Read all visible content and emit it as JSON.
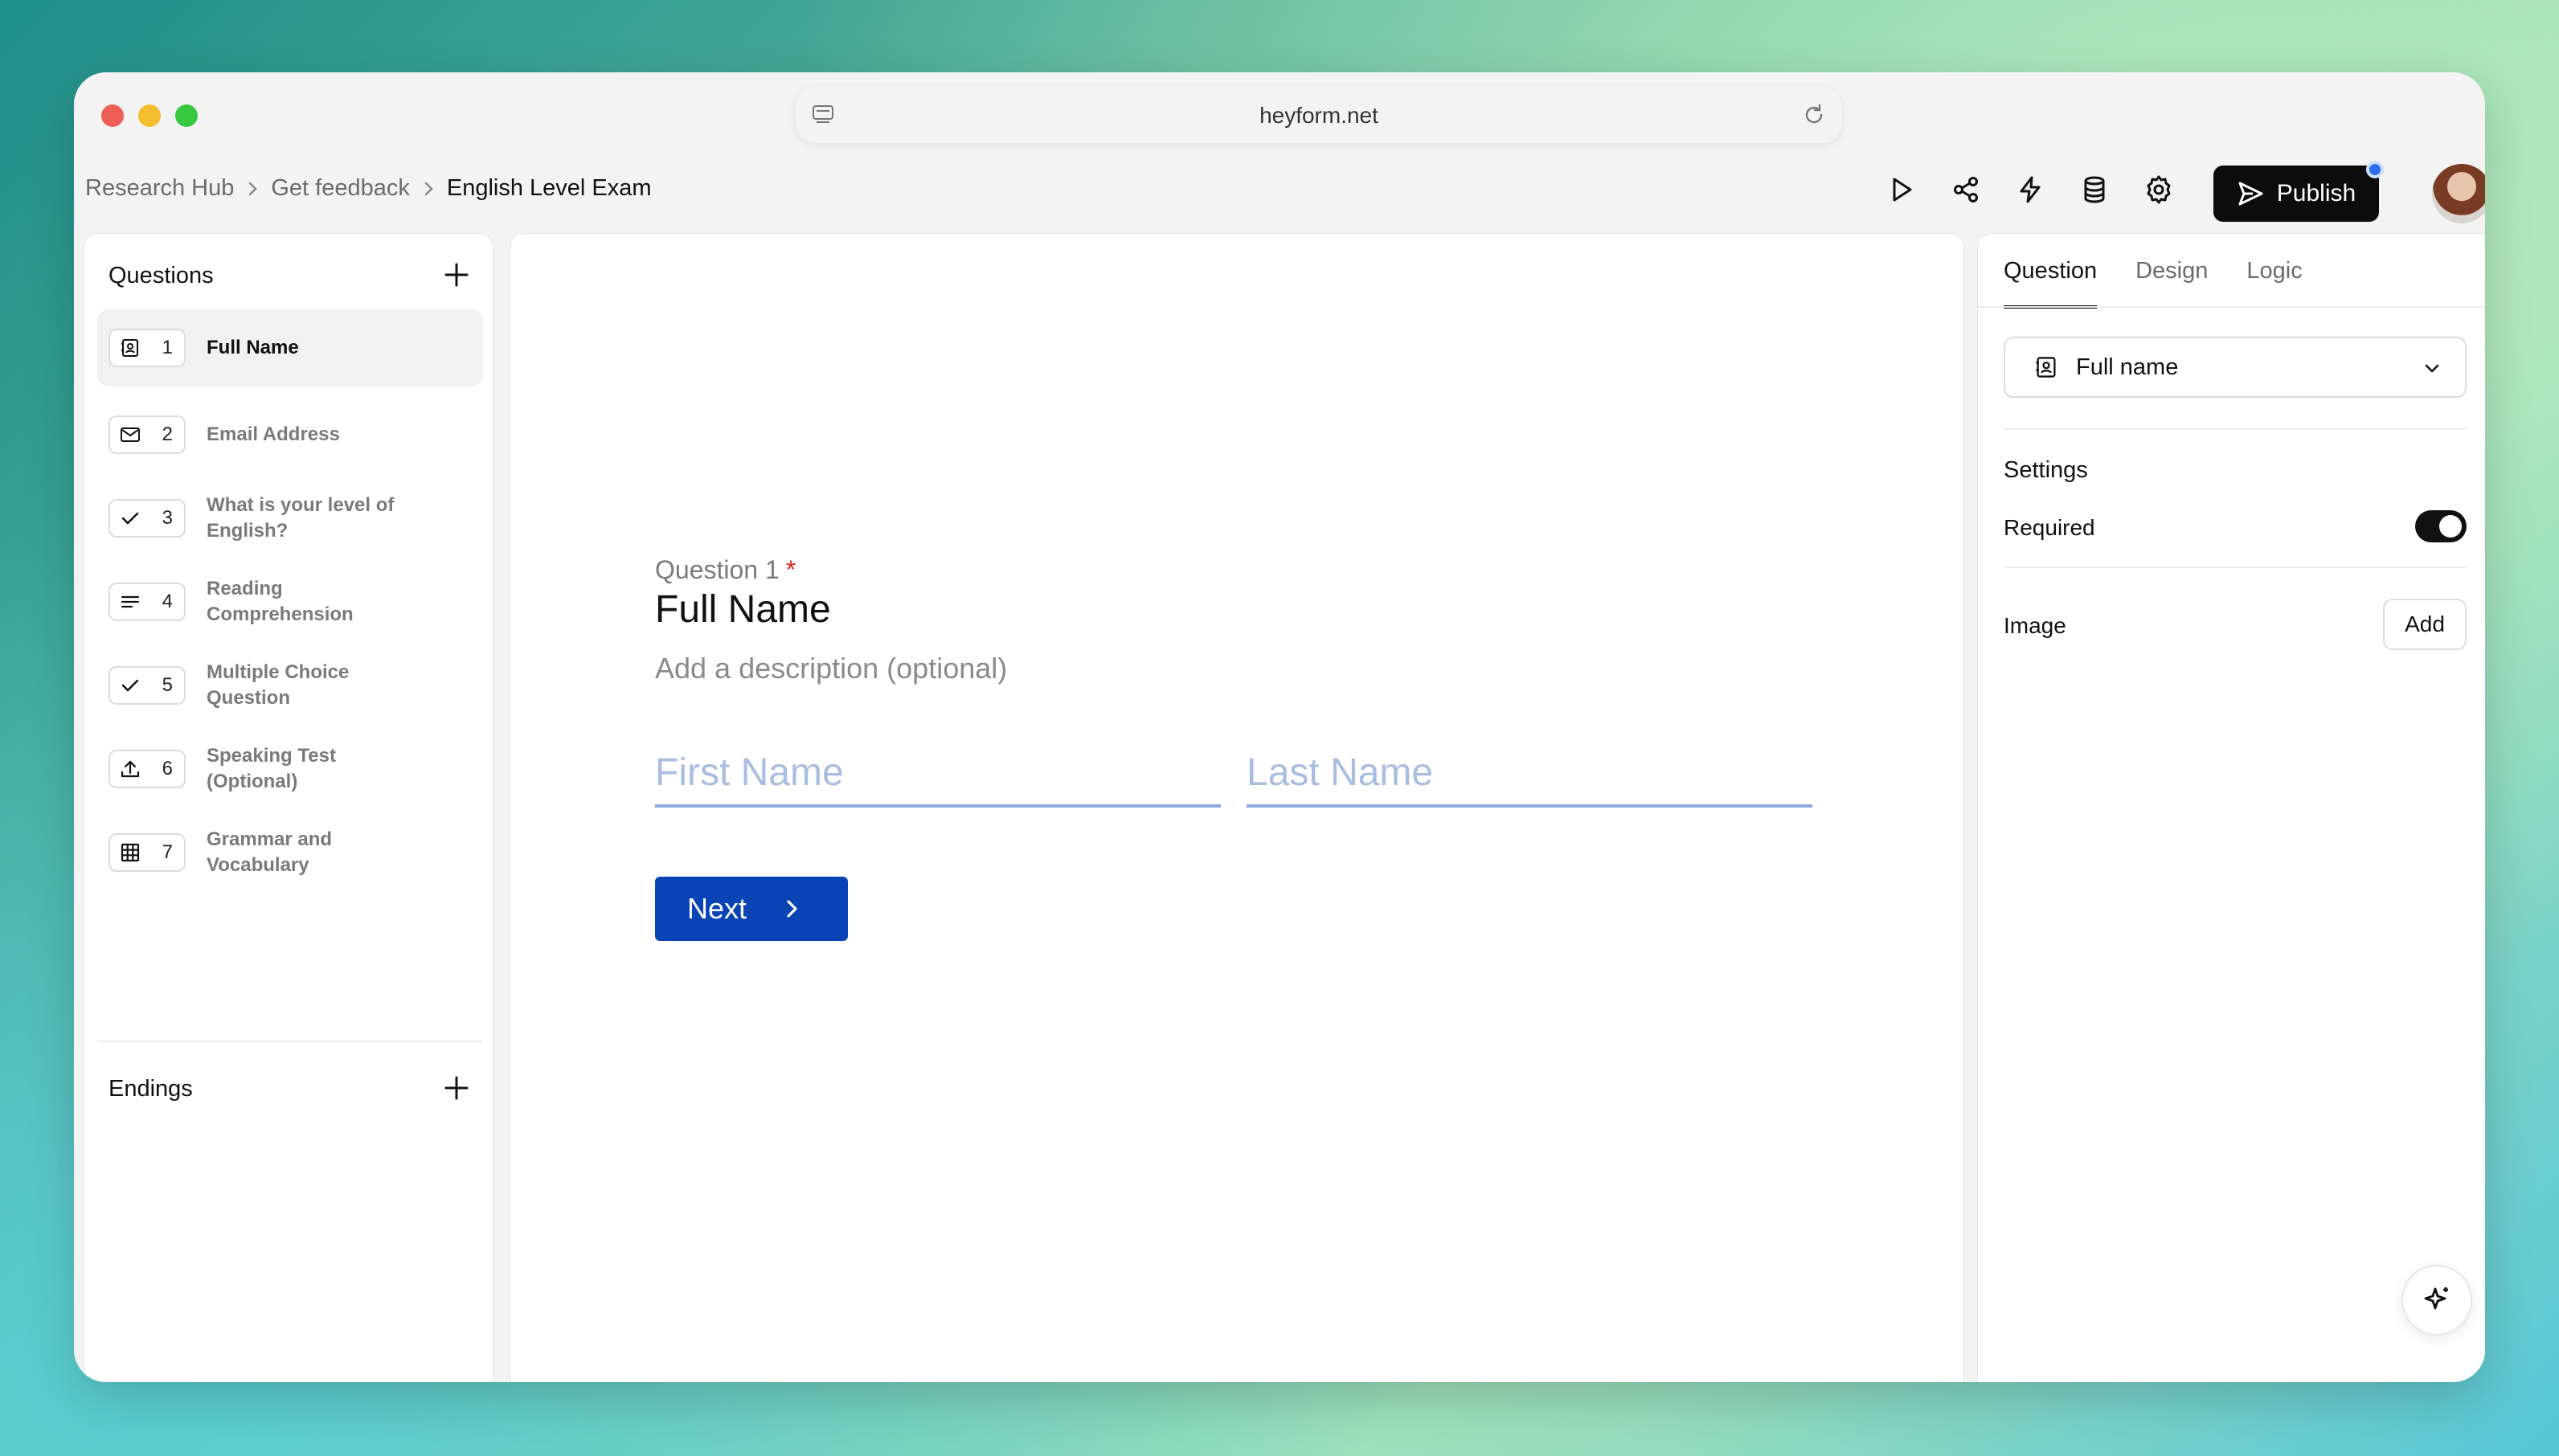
{
  "browser": {
    "url": "heyform.net"
  },
  "breadcrumb": {
    "items": [
      "Research Hub",
      "Get feedback",
      "English Level Exam"
    ]
  },
  "toolbar": {
    "publish_label": "Publish",
    "icons": [
      "play-icon",
      "share-icon",
      "lightning-icon",
      "database-icon",
      "settings-icon"
    ]
  },
  "left_panel": {
    "questions_title": "Questions",
    "endings_title": "Endings",
    "questions": [
      {
        "num": "1",
        "label": "Full Name",
        "icon": "contact-card-icon"
      },
      {
        "num": "2",
        "label": "Email Address",
        "icon": "mail-icon"
      },
      {
        "num": "3",
        "label": "What is your level of English?",
        "icon": "check-icon"
      },
      {
        "num": "4",
        "label": "Reading Comprehension",
        "icon": "text-lines-icon"
      },
      {
        "num": "5",
        "label": "Multiple Choice Question",
        "icon": "check-icon"
      },
      {
        "num": "6",
        "label": "Speaking Test (Optional)",
        "icon": "upload-icon"
      },
      {
        "num": "7",
        "label": "Grammar and Vocabulary",
        "icon": "grid-icon"
      }
    ]
  },
  "center": {
    "question_meta": "Question 1",
    "required_mark": "*",
    "title": "Full Name",
    "description": "Add a description (optional)",
    "first_name_placeholder": "First Name",
    "last_name_placeholder": "Last Name",
    "next_label": "Next"
  },
  "right_panel": {
    "tabs": [
      "Question",
      "Design",
      "Logic"
    ],
    "type_value": "Full name",
    "settings_title": "Settings",
    "required_label": "Required",
    "required_on": true,
    "image_label": "Image",
    "add_label": "Add"
  },
  "colors": {
    "accent": "#0a43b4",
    "publish_bg": "#0c0c0c",
    "required_mark": "#e02828",
    "input_underline": "#8aa8d8"
  }
}
